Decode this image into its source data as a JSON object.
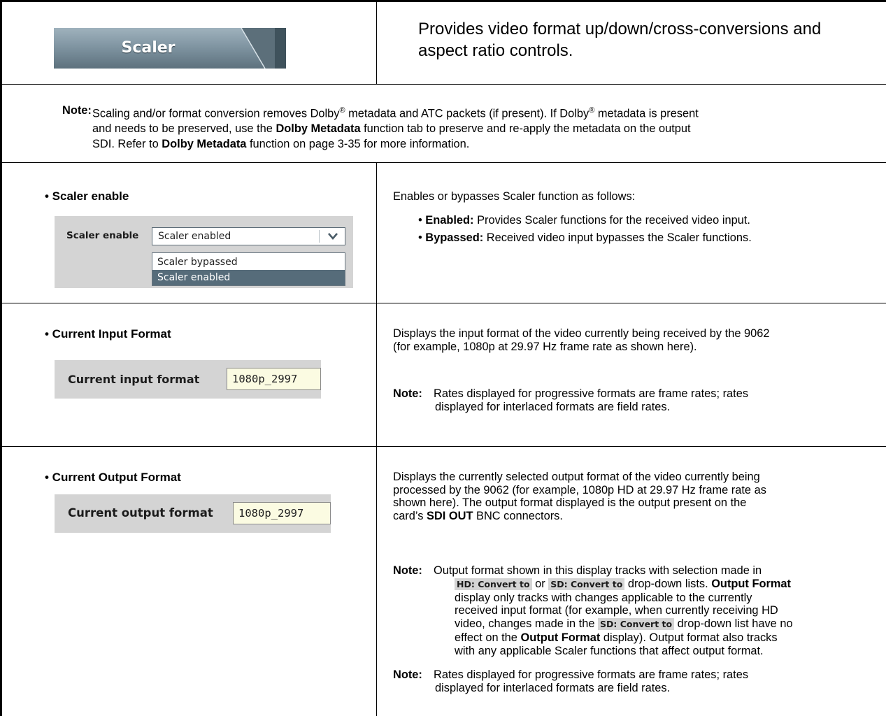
{
  "header": {
    "tab_label": "Scaler",
    "description": "Provides video format up/down/cross-conversions and aspect ratio controls."
  },
  "note": {
    "label": "Note:",
    "lines": [
      [
        "Scaling and/or format conversion removes Dolby",
        "®",
        " metadata and ATC packets (if present). If Dolby",
        "®",
        " metadata is present"
      ],
      [
        "and needs to be preserved, use the ",
        "Dolby Metadata",
        " function tab to preserve and re-apply the metadata on the output"
      ],
      [
        "SDI. Refer to ",
        "Dolby Metadata",
        " function on page 3-35 for more information."
      ]
    ]
  },
  "scaler_enable": {
    "title": "• Scaler enable",
    "ui_label": "Scaler enable",
    "selected_value": "Scaler enabled",
    "options": [
      "Scaler bypassed",
      "Scaler enabled"
    ],
    "description": "Enables or bypasses Scaler function as follows:",
    "items": [
      {
        "bullet": "• ",
        "term": "Enabled:",
        "text": " Provides Scaler functions for the received video input."
      },
      {
        "bullet": "• ",
        "term": "Bypassed:",
        "text": " Received video input bypasses the Scaler functions."
      }
    ]
  },
  "input_format": {
    "title": "• Current Input Format",
    "ui_label": "Current input format",
    "value": "1080p_2997",
    "desc_lines": [
      "Displays the input format of the video currently being received by the 9062",
      "(for example, 1080p at 29.97 Hz frame rate as shown here)."
    ],
    "note_label": "Note:",
    "note_lines": [
      "Rates displayed for progressive formats are frame rates; rates",
      "displayed for interlaced formats are field rates."
    ]
  },
  "output_format": {
    "title": "• Current Output Format",
    "ui_label": "Current output format",
    "value": "1080p_2997",
    "desc_lines": [
      "Displays the currently selected output format of the video currently being",
      "processed by the 9062 (for example, 1080p HD at 29.97 Hz frame rate as",
      "shown here). The output format displayed is the output present on the"
    ],
    "desc_last": [
      "card’s ",
      "SDI OUT",
      " BNC connectors."
    ],
    "note1_label": "Note:",
    "note1": {
      "l1": "Output format shown in this display tracks with selection made in",
      "chip_hd": "HD: Convert to",
      "or": " or ",
      "chip_sd": "SD: Convert to",
      "l2_end": " drop-down lists. ",
      "l2_bold": "Output Format",
      "l3": "display only tracks with changes applicable to the currently",
      "l4": "received input format (for example, when currently receiving HD",
      "l5_start": "video, changes made in the ",
      "chip_sd2": "SD: Convert to",
      "l5_end": " drop-down list have no",
      "l6_start": "effect on the ",
      "l6_bold": "Output Format",
      "l6_end": " display). Output format also tracks",
      "l7": "with any applicable Scaler functions that affect output format."
    },
    "note2_label": "Note:",
    "note2_lines": [
      "Rates displayed for progressive formats are frame rates; rates",
      "displayed for interlaced formats are field rates."
    ]
  }
}
